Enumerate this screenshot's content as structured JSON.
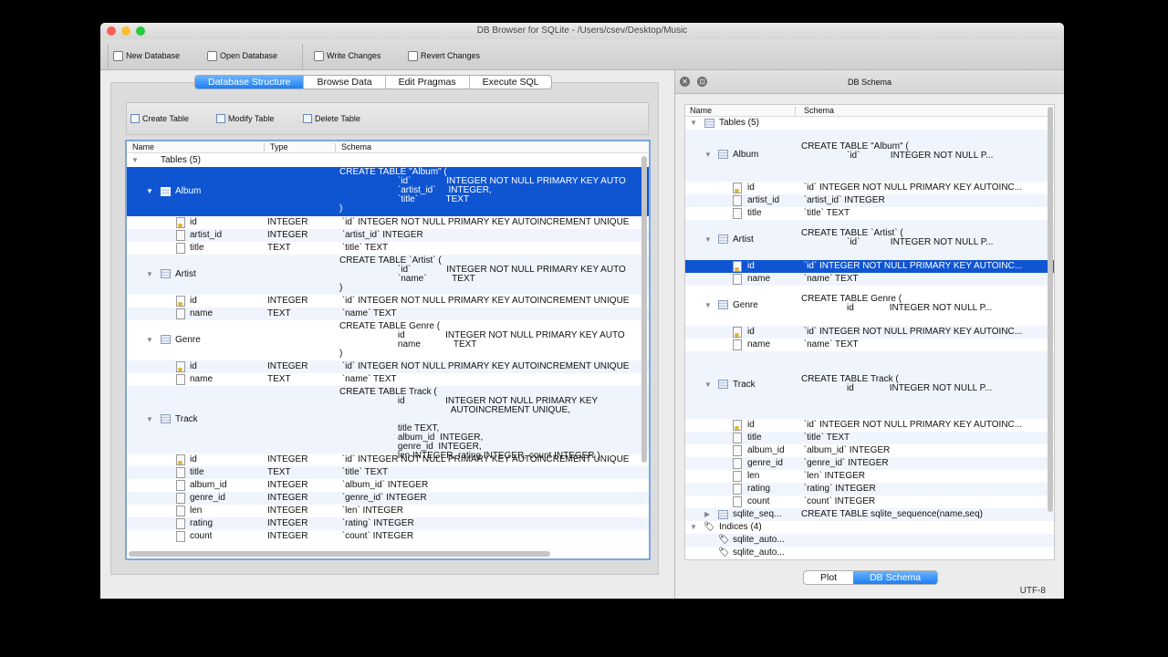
{
  "window": {
    "title": "DB Browser for SQLite - /Users/csev/Desktop/Music"
  },
  "toolbar": {
    "new_db": "New Database",
    "open_db": "Open Database",
    "write": "Write Changes",
    "revert": "Revert Changes"
  },
  "tabs": [
    "Database Structure",
    "Browse Data",
    "Edit Pragmas",
    "Execute SQL"
  ],
  "subtoolbar": {
    "create": "Create Table",
    "modify": "Modify Table",
    "delete": "Delete Table"
  },
  "main_tree": {
    "headers": [
      "Name",
      "Type",
      "Schema"
    ],
    "rows": [
      {
        "name": "Tables (5)",
        "type": "",
        "schema": ""
      },
      {
        "name": "Album",
        "type": "",
        "schema": "CREATE TABLE \"Album\" (\n                       `id`              INTEGER NOT NULL PRIMARY KEY AUTO\n                       `artist_id`     INTEGER,\n                       `title`           TEXT\n)"
      },
      {
        "name": "id",
        "type": "INTEGER",
        "schema": " `id` INTEGER NOT NULL PRIMARY KEY AUTOINCREMENT UNIQUE"
      },
      {
        "name": "artist_id",
        "type": "INTEGER",
        "schema": " `artist_id` INTEGER"
      },
      {
        "name": "title",
        "type": "TEXT",
        "schema": " `title` TEXT"
      },
      {
        "name": "Artist",
        "type": "",
        "schema": "CREATE TABLE `Artist` (\n                       `id`              INTEGER NOT NULL PRIMARY KEY AUTO\n                       `name`          TEXT\n)"
      },
      {
        "name": "id",
        "type": "INTEGER",
        "schema": " `id` INTEGER NOT NULL PRIMARY KEY AUTOINCREMENT UNIQUE"
      },
      {
        "name": "name",
        "type": "TEXT",
        "schema": " `name` TEXT"
      },
      {
        "name": "Genre",
        "type": "",
        "schema": "CREATE TABLE Genre (\n                       id                INTEGER NOT NULL PRIMARY KEY AUTO\n                       name             TEXT\n)"
      },
      {
        "name": "id",
        "type": "INTEGER",
        "schema": " `id` INTEGER NOT NULL PRIMARY KEY AUTOINCREMENT UNIQUE"
      },
      {
        "name": "name",
        "type": "TEXT",
        "schema": " `name` TEXT"
      },
      {
        "name": "Track",
        "type": "",
        "schema": "CREATE TABLE Track (\n                       id                INTEGER NOT NULL PRIMARY KEY\n                                            AUTOINCREMENT UNIQUE,\n\n                       title TEXT,\n                       album_id  INTEGER,\n                       genre_id  INTEGER,\n                       len INTEGER, rating INTEGER, count INTEGER )"
      },
      {
        "name": "id",
        "type": "INTEGER",
        "schema": " `id` INTEGER NOT NULL PRIMARY KEY AUTOINCREMENT UNIQUE"
      },
      {
        "name": "title",
        "type": "TEXT",
        "schema": " `title` TEXT"
      },
      {
        "name": "album_id",
        "type": "INTEGER",
        "schema": " `album_id` INTEGER"
      },
      {
        "name": "genre_id",
        "type": "INTEGER",
        "schema": " `genre_id` INTEGER"
      },
      {
        "name": "len",
        "type": "INTEGER",
        "schema": " `len` INTEGER"
      },
      {
        "name": "rating",
        "type": "INTEGER",
        "schema": " `rating` INTEGER"
      },
      {
        "name": "count",
        "type": "INTEGER",
        "schema": " `count` INTEGER"
      }
    ]
  },
  "schema_panel": {
    "title": "DB Schema",
    "headers": [
      "Name",
      "Schema"
    ],
    "rows": [
      {
        "name": "Tables (5)",
        "schema": ""
      },
      {
        "name": "Album",
        "schema": "CREATE TABLE \"Album\" (\n                  `id`            INTEGER NOT NULL P..."
      },
      {
        "name": "id",
        "schema": " `id` INTEGER NOT NULL PRIMARY KEY AUTOINC..."
      },
      {
        "name": "artist_id",
        "schema": " `artist_id` INTEGER"
      },
      {
        "name": "title",
        "schema": " `title` TEXT"
      },
      {
        "name": "Artist",
        "schema": "CREATE TABLE `Artist` (\n                  `id`            INTEGER NOT NULL P..."
      },
      {
        "name": "id",
        "schema": " `id` INTEGER NOT NULL PRIMARY KEY AUTOINC..."
      },
      {
        "name": "name",
        "schema": " `name` TEXT"
      },
      {
        "name": "Genre",
        "schema": "CREATE TABLE Genre (\n                  id              INTEGER NOT NULL P..."
      },
      {
        "name": "id",
        "schema": " `id` INTEGER NOT NULL PRIMARY KEY AUTOINC..."
      },
      {
        "name": "name",
        "schema": " `name` TEXT"
      },
      {
        "name": "Track",
        "schema": "CREATE TABLE Track (\n                  id              INTEGER NOT NULL P..."
      },
      {
        "name": "id",
        "schema": " `id` INTEGER NOT NULL PRIMARY KEY AUTOINC..."
      },
      {
        "name": "title",
        "schema": " `title` TEXT"
      },
      {
        "name": "album_id",
        "schema": " `album_id` INTEGER"
      },
      {
        "name": "genre_id",
        "schema": " `genre_id` INTEGER"
      },
      {
        "name": "len",
        "schema": " `len` INTEGER"
      },
      {
        "name": "rating",
        "schema": " `rating` INTEGER"
      },
      {
        "name": "count",
        "schema": " `count` INTEGER"
      },
      {
        "name": "sqlite_seq...",
        "schema": "CREATE TABLE sqlite_sequence(name,seq)"
      },
      {
        "name": "Indices (4)",
        "schema": ""
      },
      {
        "name": "sqlite_auto...",
        "schema": ""
      },
      {
        "name": "sqlite_auto...",
        "schema": ""
      }
    ]
  },
  "bottom_tabs": [
    "Plot",
    "DB Schema"
  ],
  "status": {
    "encoding": "UTF-8"
  }
}
